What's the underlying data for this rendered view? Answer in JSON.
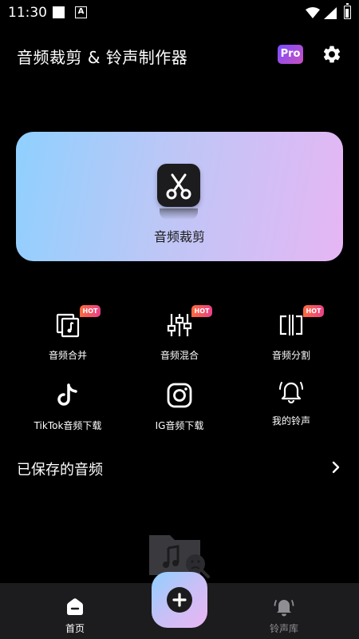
{
  "status_bar": {
    "time": "11:30"
  },
  "header": {
    "title": "音频裁剪 & 铃声制作器",
    "pro_label": "Pro"
  },
  "hero": {
    "label": "音频裁剪"
  },
  "tools": [
    {
      "label": "音频合并",
      "badge": "HOT",
      "icon": "merge-icon"
    },
    {
      "label": "音频混合",
      "badge": "HOT",
      "icon": "mixer-icon"
    },
    {
      "label": "音频分割",
      "badge": "HOT",
      "icon": "split-icon"
    },
    {
      "label": "TikTok音频下载",
      "icon": "tiktok-icon"
    },
    {
      "label": "IG音频下载",
      "icon": "instagram-icon"
    },
    {
      "label": "我的铃声",
      "icon": "bell-icon"
    }
  ],
  "saved": {
    "label": "已保存的音频"
  },
  "bottom_nav": {
    "home_label": "首页",
    "ringtones_label": "铃声库"
  },
  "colors": {
    "background": "#000000",
    "nav_background": "#1c1c1e",
    "hot_badge": "#ff6a3d",
    "hero_start": "#8fd0ff",
    "hero_end": "#e6b6f4"
  }
}
